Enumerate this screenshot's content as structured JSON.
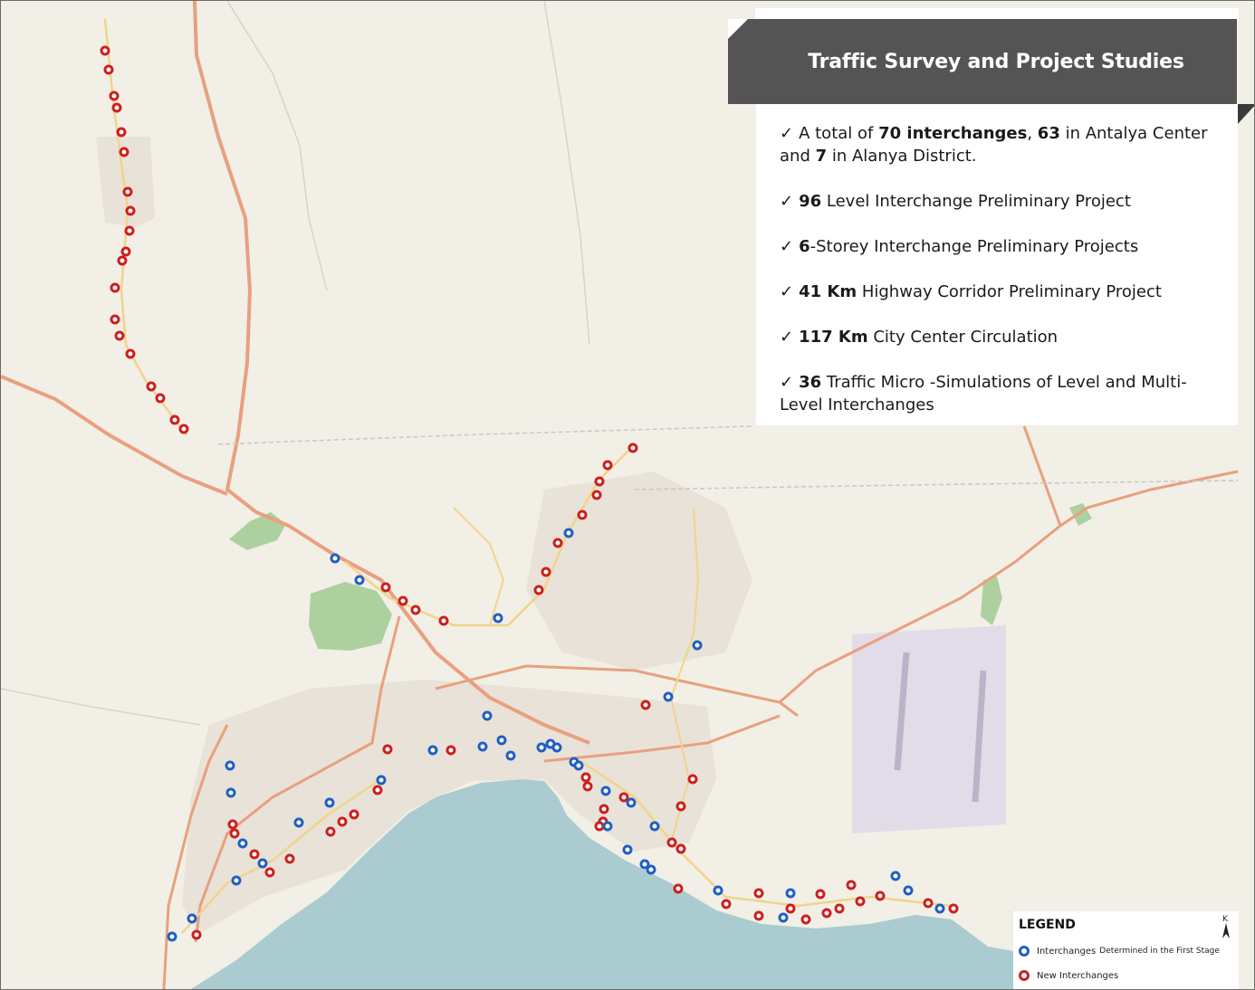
{
  "title": "Traffic Survey and Project Studies",
  "info": [
    {
      "parts": [
        {
          "t": "A total of ",
          "b": false
        },
        {
          "t": "70 interchanges",
          "b": true
        },
        {
          "t": ", ",
          "b": false
        },
        {
          "t": "63",
          "b": true
        },
        {
          "t": " in Antalya Center and ",
          "b": false
        },
        {
          "t": "7",
          "b": true
        },
        {
          "t": " in Alanya District.",
          "b": false
        }
      ]
    },
    {
      "parts": [
        {
          "t": "96",
          "b": true
        },
        {
          "t": " Level Interchange Preliminary Project",
          "b": false
        }
      ]
    },
    {
      "parts": [
        {
          "t": "6",
          "b": true
        },
        {
          "t": "-Storey Interchange Preliminary Projects",
          "b": false
        }
      ]
    },
    {
      "parts": [
        {
          "t": "41 Km",
          "b": true
        },
        {
          "t": " Highway Corridor Preliminary Project",
          "b": false
        }
      ]
    },
    {
      "parts": [
        {
          "t": "117 Km",
          "b": true
        },
        {
          "t": " City Center Circulation",
          "b": false
        }
      ]
    },
    {
      "parts": [
        {
          "t": "36",
          "b": true
        },
        {
          "t": " Traffic Micro -Simulations of Level and Multi-Level Interchanges",
          "b": false
        }
      ]
    }
  ],
  "check_glyph": "✓",
  "legend": {
    "title": "LEGEND",
    "first_stage_label": "Interchanges",
    "first_stage_label_small": "Determined in the First Stage",
    "new_label": "New  Interchanges"
  },
  "north_label": "K",
  "colors": {
    "first_stage": "#1f5fc4",
    "new": "#cc1f1f",
    "sea": "#aacbd0",
    "land": "#f2efe6",
    "park": "#add19e",
    "motorway": "#e8a07f",
    "banner": "#545454"
  },
  "markers": {
    "new": [
      [
        115,
        55
      ],
      [
        119,
        76
      ],
      [
        125,
        105
      ],
      [
        128,
        118
      ],
      [
        133,
        145
      ],
      [
        136,
        167
      ],
      [
        140,
        211
      ],
      [
        143,
        232
      ],
      [
        142,
        254
      ],
      [
        138,
        277
      ],
      [
        134,
        287
      ],
      [
        126,
        317
      ],
      [
        126,
        352
      ],
      [
        131,
        370
      ],
      [
        143,
        390
      ],
      [
        166,
        426
      ],
      [
        176,
        439
      ],
      [
        192,
        463
      ],
      [
        202,
        473
      ],
      [
        698,
        494
      ],
      [
        670,
        513
      ],
      [
        661,
        531
      ],
      [
        658,
        546
      ],
      [
        642,
        568
      ],
      [
        615,
        599
      ],
      [
        602,
        631
      ],
      [
        594,
        651
      ],
      [
        425,
        648
      ],
      [
        444,
        663
      ],
      [
        458,
        673
      ],
      [
        489,
        685
      ],
      [
        712,
        778
      ],
      [
        427,
        827
      ],
      [
        497,
        828
      ],
      [
        764,
        860
      ],
      [
        751,
        890
      ],
      [
        646,
        858
      ],
      [
        648,
        868
      ],
      [
        688,
        880
      ],
      [
        666,
        893
      ],
      [
        665,
        907
      ],
      [
        661,
        912
      ],
      [
        416,
        872
      ],
      [
        390,
        899
      ],
      [
        377,
        907
      ],
      [
        364,
        918
      ],
      [
        319,
        948
      ],
      [
        297,
        963
      ],
      [
        256,
        910
      ],
      [
        258,
        920
      ],
      [
        280,
        943
      ],
      [
        216,
        1032
      ],
      [
        741,
        930
      ],
      [
        751,
        937
      ],
      [
        748,
        981
      ],
      [
        801,
        998
      ],
      [
        837,
        986
      ],
      [
        837,
        1011
      ],
      [
        872,
        1003
      ],
      [
        889,
        1015
      ],
      [
        905,
        987
      ],
      [
        912,
        1008
      ],
      [
        926,
        1003
      ],
      [
        939,
        977
      ],
      [
        949,
        995
      ],
      [
        971,
        989
      ],
      [
        1024,
        997
      ],
      [
        1052,
        1003
      ]
    ],
    "first_stage": [
      [
        369,
        616
      ],
      [
        396,
        640
      ],
      [
        549,
        682
      ],
      [
        627,
        588
      ],
      [
        769,
        712
      ],
      [
        737,
        769
      ],
      [
        537,
        790
      ],
      [
        477,
        828
      ],
      [
        532,
        824
      ],
      [
        553,
        817
      ],
      [
        563,
        834
      ],
      [
        597,
        825
      ],
      [
        607,
        821
      ],
      [
        614,
        825
      ],
      [
        633,
        841
      ],
      [
        638,
        845
      ],
      [
        420,
        861
      ],
      [
        363,
        886
      ],
      [
        329,
        908
      ],
      [
        253,
        845
      ],
      [
        254,
        875
      ],
      [
        267,
        931
      ],
      [
        289,
        953
      ],
      [
        260,
        972
      ],
      [
        211,
        1014
      ],
      [
        189,
        1034
      ],
      [
        668,
        873
      ],
      [
        696,
        886
      ],
      [
        670,
        912
      ],
      [
        722,
        912
      ],
      [
        692,
        938
      ],
      [
        711,
        954
      ],
      [
        718,
        960
      ],
      [
        792,
        983
      ],
      [
        872,
        986
      ],
      [
        864,
        1013
      ],
      [
        988,
        967
      ],
      [
        1002,
        983
      ],
      [
        1037,
        1003
      ]
    ]
  }
}
